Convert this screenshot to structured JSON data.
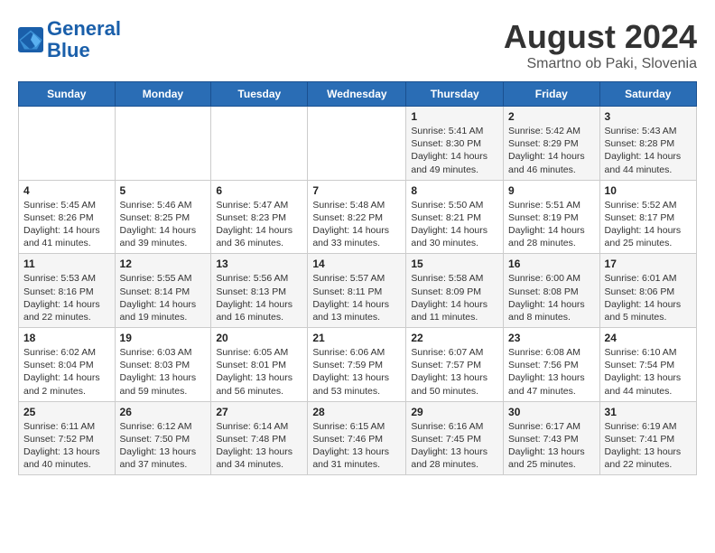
{
  "header": {
    "logo_line1": "General",
    "logo_line2": "Blue",
    "month_title": "August 2024",
    "location": "Smartno ob Paki, Slovenia"
  },
  "weekdays": [
    "Sunday",
    "Monday",
    "Tuesday",
    "Wednesday",
    "Thursday",
    "Friday",
    "Saturday"
  ],
  "weeks": [
    [
      {
        "day": "",
        "info": ""
      },
      {
        "day": "",
        "info": ""
      },
      {
        "day": "",
        "info": ""
      },
      {
        "day": "",
        "info": ""
      },
      {
        "day": "1",
        "info": "Sunrise: 5:41 AM\nSunset: 8:30 PM\nDaylight: 14 hours\nand 49 minutes."
      },
      {
        "day": "2",
        "info": "Sunrise: 5:42 AM\nSunset: 8:29 PM\nDaylight: 14 hours\nand 46 minutes."
      },
      {
        "day": "3",
        "info": "Sunrise: 5:43 AM\nSunset: 8:28 PM\nDaylight: 14 hours\nand 44 minutes."
      }
    ],
    [
      {
        "day": "4",
        "info": "Sunrise: 5:45 AM\nSunset: 8:26 PM\nDaylight: 14 hours\nand 41 minutes."
      },
      {
        "day": "5",
        "info": "Sunrise: 5:46 AM\nSunset: 8:25 PM\nDaylight: 14 hours\nand 39 minutes."
      },
      {
        "day": "6",
        "info": "Sunrise: 5:47 AM\nSunset: 8:23 PM\nDaylight: 14 hours\nand 36 minutes."
      },
      {
        "day": "7",
        "info": "Sunrise: 5:48 AM\nSunset: 8:22 PM\nDaylight: 14 hours\nand 33 minutes."
      },
      {
        "day": "8",
        "info": "Sunrise: 5:50 AM\nSunset: 8:21 PM\nDaylight: 14 hours\nand 30 minutes."
      },
      {
        "day": "9",
        "info": "Sunrise: 5:51 AM\nSunset: 8:19 PM\nDaylight: 14 hours\nand 28 minutes."
      },
      {
        "day": "10",
        "info": "Sunrise: 5:52 AM\nSunset: 8:17 PM\nDaylight: 14 hours\nand 25 minutes."
      }
    ],
    [
      {
        "day": "11",
        "info": "Sunrise: 5:53 AM\nSunset: 8:16 PM\nDaylight: 14 hours\nand 22 minutes."
      },
      {
        "day": "12",
        "info": "Sunrise: 5:55 AM\nSunset: 8:14 PM\nDaylight: 14 hours\nand 19 minutes."
      },
      {
        "day": "13",
        "info": "Sunrise: 5:56 AM\nSunset: 8:13 PM\nDaylight: 14 hours\nand 16 minutes."
      },
      {
        "day": "14",
        "info": "Sunrise: 5:57 AM\nSunset: 8:11 PM\nDaylight: 14 hours\nand 13 minutes."
      },
      {
        "day": "15",
        "info": "Sunrise: 5:58 AM\nSunset: 8:09 PM\nDaylight: 14 hours\nand 11 minutes."
      },
      {
        "day": "16",
        "info": "Sunrise: 6:00 AM\nSunset: 8:08 PM\nDaylight: 14 hours\nand 8 minutes."
      },
      {
        "day": "17",
        "info": "Sunrise: 6:01 AM\nSunset: 8:06 PM\nDaylight: 14 hours\nand 5 minutes."
      }
    ],
    [
      {
        "day": "18",
        "info": "Sunrise: 6:02 AM\nSunset: 8:04 PM\nDaylight: 14 hours\nand 2 minutes."
      },
      {
        "day": "19",
        "info": "Sunrise: 6:03 AM\nSunset: 8:03 PM\nDaylight: 13 hours\nand 59 minutes."
      },
      {
        "day": "20",
        "info": "Sunrise: 6:05 AM\nSunset: 8:01 PM\nDaylight: 13 hours\nand 56 minutes."
      },
      {
        "day": "21",
        "info": "Sunrise: 6:06 AM\nSunset: 7:59 PM\nDaylight: 13 hours\nand 53 minutes."
      },
      {
        "day": "22",
        "info": "Sunrise: 6:07 AM\nSunset: 7:57 PM\nDaylight: 13 hours\nand 50 minutes."
      },
      {
        "day": "23",
        "info": "Sunrise: 6:08 AM\nSunset: 7:56 PM\nDaylight: 13 hours\nand 47 minutes."
      },
      {
        "day": "24",
        "info": "Sunrise: 6:10 AM\nSunset: 7:54 PM\nDaylight: 13 hours\nand 44 minutes."
      }
    ],
    [
      {
        "day": "25",
        "info": "Sunrise: 6:11 AM\nSunset: 7:52 PM\nDaylight: 13 hours\nand 40 minutes."
      },
      {
        "day": "26",
        "info": "Sunrise: 6:12 AM\nSunset: 7:50 PM\nDaylight: 13 hours\nand 37 minutes."
      },
      {
        "day": "27",
        "info": "Sunrise: 6:14 AM\nSunset: 7:48 PM\nDaylight: 13 hours\nand 34 minutes."
      },
      {
        "day": "28",
        "info": "Sunrise: 6:15 AM\nSunset: 7:46 PM\nDaylight: 13 hours\nand 31 minutes."
      },
      {
        "day": "29",
        "info": "Sunrise: 6:16 AM\nSunset: 7:45 PM\nDaylight: 13 hours\nand 28 minutes."
      },
      {
        "day": "30",
        "info": "Sunrise: 6:17 AM\nSunset: 7:43 PM\nDaylight: 13 hours\nand 25 minutes."
      },
      {
        "day": "31",
        "info": "Sunrise: 6:19 AM\nSunset: 7:41 PM\nDaylight: 13 hours\nand 22 minutes."
      }
    ]
  ]
}
